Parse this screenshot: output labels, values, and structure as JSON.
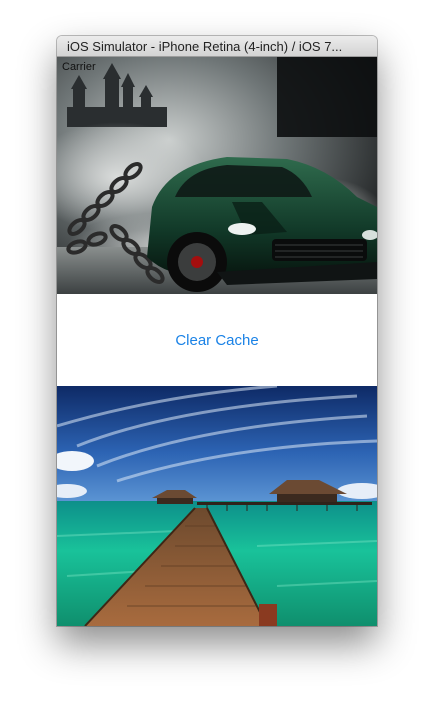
{
  "window": {
    "title": "iOS Simulator - iPhone Retina (4-inch) / iOS 7..."
  },
  "status_bar": {
    "carrier": "Carrier"
  },
  "main": {
    "clear_cache_label": "Clear Cache"
  }
}
